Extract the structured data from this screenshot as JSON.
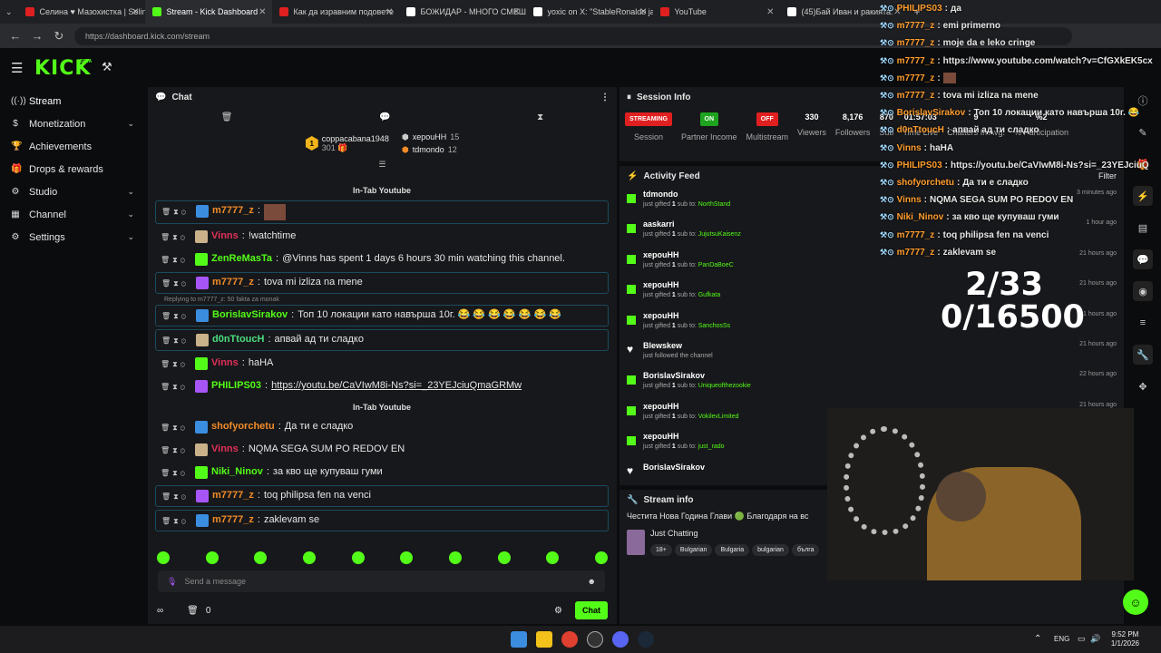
{
  "browser": {
    "tabs": [
      {
        "title": "Селина ♥ Мазохистка | Selin",
        "color": "#e02020"
      },
      {
        "title": "Stream - Kick Dashboard",
        "color": "#53fc18",
        "active": true
      },
      {
        "title": "Как да изравним подовете",
        "color": "#e02020"
      },
      {
        "title": "БОЖИДАР - МНОГО СМЕШ",
        "color": "#ffffff"
      },
      {
        "title": "yoxic on X: \"StableRonaldo ja",
        "color": "#ffffff"
      },
      {
        "title": "YouTube",
        "color": "#e02020"
      },
      {
        "title": "(45)Бай Иван и ракията:",
        "color": "#ffffff"
      }
    ],
    "url": "https://dashboard.kick.com/stream"
  },
  "app": {
    "logo": "KICK",
    "logo_sup": "BETA"
  },
  "sidebar": {
    "items": [
      {
        "label": "Stream",
        "icon": "broadcast-icon"
      },
      {
        "label": "Monetization",
        "icon": "dollar-icon",
        "chevron": true
      },
      {
        "label": "Achievements",
        "icon": "trophy-icon"
      },
      {
        "label": "Drops & rewards",
        "icon": "gift-icon"
      },
      {
        "label": "Studio",
        "icon": "studio-icon",
        "chevron": true
      },
      {
        "label": "Channel",
        "icon": "channel-icon",
        "chevron": true
      },
      {
        "label": "Settings",
        "icon": "gear-icon",
        "chevron": true
      }
    ]
  },
  "chat": {
    "title": "Chat",
    "gifters": [
      {
        "name": "coppacabana1948",
        "count": "301"
      },
      {
        "name": "xepouHH",
        "count": "15"
      },
      {
        "name": "tdmondo",
        "count": "12"
      }
    ],
    "separator1": "In-Tab Youtube",
    "separator2": "In-Tab Youtube",
    "reply_text": "Replying to m7777_z: 50 fakta za monak",
    "messages": [
      {
        "user": "m7777_z",
        "color": "#f28c28",
        "text": "",
        "hl": true
      },
      {
        "user": "Vinns",
        "color": "#e0305a",
        "text": "!watchtime"
      },
      {
        "user": "ZenReMasTa",
        "color": "#53fc18",
        "text": "@Vinns has spent 1 days 6 hours 30 min watching this channel."
      },
      {
        "user": "m7777_z",
        "color": "#f28c28",
        "text": "tova mi izliza na mene",
        "hl": true
      },
      {
        "user": "BorislavSirakov",
        "color": "#53fc18",
        "text": "Топ 10 локации като навърша 10г. 😂 😂 😂 😂 😂 😂 😂",
        "hl": true
      },
      {
        "user": "d0nTtoucH",
        "color": "#4ade80",
        "text": "апвай ад ти сладко",
        "hl": true
      },
      {
        "user": "Vinns",
        "color": "#e0305a",
        "text": "haHA"
      },
      {
        "user": "PHILIPS03",
        "color": "#53fc18",
        "text": "https://youtu.be/CaVIwM8i-Ns?si=_23YEJciuQmaGRMw",
        "link": true
      },
      {
        "user": "shofyorchetu",
        "color": "#f28c28",
        "text": "Да ти е сладко"
      },
      {
        "user": "Vinns",
        "color": "#e0305a",
        "text": "NQMA SEGA SUM PO REDOV EN"
      },
      {
        "user": "Niki_Ninov",
        "color": "#53fc18",
        "text": "за кво ще купуваш гуми"
      },
      {
        "user": "m7777_z",
        "color": "#f28c28",
        "text": "toq philipsa fen na venci",
        "hl": true
      },
      {
        "user": "m7777_z",
        "color": "#f28c28",
        "text": "zaklevam se",
        "hl": true
      }
    ],
    "send_placeholder": "Send a message",
    "footer_count": "0",
    "chat_button": "Chat"
  },
  "session": {
    "title": "Session Info",
    "items": [
      {
        "pill": "STREAMING",
        "pill_color": "#e02020",
        "label": "Session"
      },
      {
        "pill": "ON",
        "pill_color": "#1ea41e",
        "label": "Partner Income"
      },
      {
        "pill": "OFF",
        "pill_color": "#e02020",
        "label": "Multistream"
      },
      {
        "value": "330",
        "label": "Viewers"
      },
      {
        "value": "8,176",
        "label": "Followers"
      },
      {
        "value": "870",
        "label": "Sub"
      },
      {
        "value": "01:57:03",
        "label": "Time Live"
      },
      {
        "value": "9",
        "label": "Chatters In Avg."
      },
      {
        "value": "%2",
        "label": "% Participation"
      }
    ]
  },
  "activity": {
    "title": "Activity Feed",
    "filter": "Filter",
    "items": [
      {
        "name": "tdmondo",
        "action": "just gifted",
        "qty": "1",
        "to": "NorthStand",
        "time": "3 minutes ago"
      },
      {
        "name": "aaskarri",
        "action": "just gifted",
        "qty": "1",
        "to": "JujutsuKaisenz",
        "time": "1 hour ago"
      },
      {
        "name": "xepouHH",
        "action": "just gifted",
        "qty": "1",
        "to": "PanDaBoeC",
        "time": "21 hours ago"
      },
      {
        "name": "xepouHH",
        "action": "just gifted",
        "qty": "1",
        "to": "Gufkata",
        "time": "21 hours ago"
      },
      {
        "name": "xepouHH",
        "action": "just gifted",
        "qty": "1",
        "to": "SanchosSs",
        "time": "21 hours ago"
      },
      {
        "name": "Blewskew",
        "action": "just followed the channel",
        "qty": "",
        "to": "",
        "time": "21 hours ago"
      },
      {
        "name": "BorislavSirakov",
        "action": "just gifted",
        "qty": "1",
        "to": "Uniqueofthezookie",
        "time": "22 hours ago"
      },
      {
        "name": "xepouHH",
        "action": "just gifted",
        "qty": "1",
        "to": "VokilevLimited",
        "time": "21 hours ago"
      },
      {
        "name": "xepouHH",
        "action": "just gifted",
        "qty": "1",
        "to": "just_rado",
        "time": "21 hours ago"
      },
      {
        "name": "BorislavSirakov",
        "action": "",
        "qty": "",
        "to": "",
        "time": ""
      }
    ]
  },
  "streaminfo": {
    "title": "Stream info",
    "stream_title": "Честита Нова Година Глави 🟢 Благодаря на вс",
    "category": "Just Chatting",
    "tags": [
      "18+",
      "Bulgarian",
      "Bulgaria",
      "bulgarian",
      "бълга"
    ]
  },
  "overlay": {
    "lines": [
      {
        "user": "PHILIPS03",
        "text": "да"
      },
      {
        "user": "m7777_z",
        "text": "emi primerno"
      },
      {
        "user": "m7777_z",
        "text": "moje da e leko cringe"
      },
      {
        "user": "m7777_z",
        "text": "https://www.youtube.com/watch?v=CfGXkEK5cx"
      },
      {
        "user": "m7777_z",
        "text": ""
      },
      {
        "user": "m7777_z",
        "text": "tova mi izliza na mene"
      },
      {
        "user": "BorislavSirakov",
        "text": "Топ 10 локации като навърша 10г. 😂"
      },
      {
        "user": "d0nTtoucH",
        "text": "апвай ад ти сладко"
      },
      {
        "user": "Vinns",
        "text": "haHA"
      },
      {
        "user": "PHILIPS03",
        "text": "https://youtu.be/CaVIwM8i-Ns?si=_23YEJciuQ"
      },
      {
        "user": "shofyorchetu",
        "text": "Да ти е сладко"
      },
      {
        "user": "Vinns",
        "text": "NQMA SEGA SUM PO REDOV EN"
      },
      {
        "user": "Niki_Ninov",
        "text": "за кво ще купуваш гуми"
      },
      {
        "user": "m7777_z",
        "text": "toq philipsa fen na venci"
      },
      {
        "user": "m7777_z",
        "text": "zaklevam se"
      }
    ],
    "counter1": "2/33",
    "counter2": "0/16500"
  },
  "taskbar": {
    "lang": "ENG",
    "time": "9:52 PM",
    "date": "1/1/2026"
  }
}
